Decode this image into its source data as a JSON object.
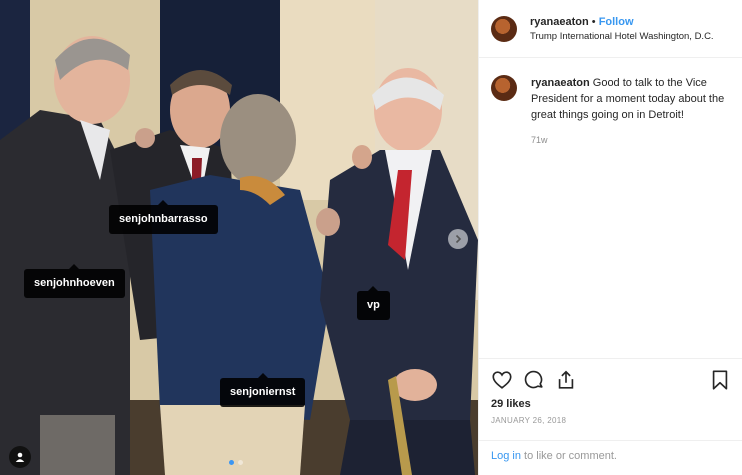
{
  "photo": {
    "tags": [
      {
        "label": "senjohnbarrasso"
      },
      {
        "label": "senjohnhoeven"
      },
      {
        "label": "vp"
      },
      {
        "label": "senjoniernst"
      }
    ],
    "carousel": {
      "total": 2,
      "current": 1
    },
    "next_icon": "chevron-right-icon",
    "user_tag_icon": "person-icon"
  },
  "header": {
    "username": "ryanaeaton",
    "separator": "•",
    "follow_label": "Follow",
    "location": "Trump International Hotel Washington, D.C."
  },
  "caption": {
    "username": "ryanaeaton",
    "text": "Good to talk to the Vice President for a moment today about the great things going on in Detroit!",
    "time": "71w"
  },
  "actions": {
    "icons": [
      "heart-icon",
      "comment-icon",
      "share-icon",
      "bookmark-icon"
    ],
    "likes": "29 likes",
    "date": "JANUARY 26, 2018"
  },
  "login": {
    "link_label": "Log in",
    "rest": " to like or comment."
  },
  "colors": {
    "accent": "#3897f0",
    "muted": "#8e8e8e"
  }
}
